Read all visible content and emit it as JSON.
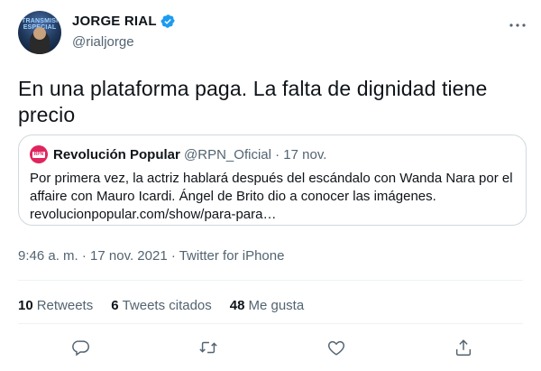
{
  "author": {
    "display_name": "JORGE RIAL",
    "handle": "@rialjorge",
    "avatar_text": "TRANSMISIÓN ESPECIAL",
    "verified_icon": "verified-badge-icon"
  },
  "tweet": {
    "text": "En una plataforma paga. La falta de dignidad tiene precio"
  },
  "quote": {
    "avatar_text": "RPN",
    "name": "Revolución Popular",
    "handle": "@RPN_Oficial",
    "separator": "·",
    "date": "17 nov.",
    "lines": [
      "Por primera vez, la actriz hablará después del escándalo con Wanda Nara por el",
      "affaire con Mauro Icardi. Ángel de Brito dio a conocer las imágenes.",
      "revolucionpopular.com/show/para-para…"
    ]
  },
  "meta": {
    "text": "9:46 a. m. · 17 nov. 2021 · Twitter for iPhone"
  },
  "stats": {
    "retweets_count": "10",
    "retweets_label": "Retweets",
    "quotes_count": "6",
    "quotes_label": "Tweets citados",
    "likes_count": "48",
    "likes_label": "Me gusta"
  },
  "actions": [
    "reply-icon",
    "retweet-icon",
    "like-icon",
    "share-icon"
  ],
  "colors": {
    "text": "#0f1419",
    "secondary": "#536471",
    "accent": "#1d9bf0",
    "border": "#cfd9de"
  }
}
